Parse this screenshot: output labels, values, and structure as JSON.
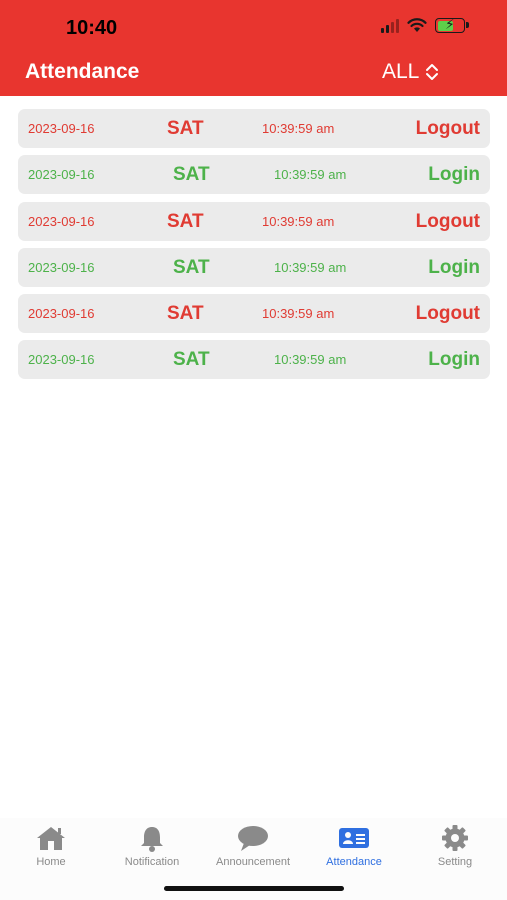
{
  "status_bar": {
    "time": "10:40"
  },
  "header": {
    "title": "Attendance",
    "filter_value": "ALL",
    "background": "#e8352f"
  },
  "records": [
    {
      "date": "2023-09-16",
      "day": "SAT",
      "time": "10:39:59 am",
      "action": "Logout",
      "type": "logout"
    },
    {
      "date": "2023-09-16",
      "day": "SAT",
      "time": "10:39:59 am",
      "action": "Login",
      "type": "login"
    },
    {
      "date": "2023-09-16",
      "day": "SAT",
      "time": "10:39:59 am",
      "action": "Logout",
      "type": "logout"
    },
    {
      "date": "2023-09-16",
      "day": "SAT",
      "time": "10:39:59 am",
      "action": "Login",
      "type": "login"
    },
    {
      "date": "2023-09-16",
      "day": "SAT",
      "time": "10:39:59 am",
      "action": "Logout",
      "type": "logout"
    },
    {
      "date": "2023-09-16",
      "day": "SAT",
      "time": "10:39:59 am",
      "action": "Login",
      "type": "login"
    }
  ],
  "colors": {
    "logout": "#e03b33",
    "login": "#4db24a",
    "active_tab": "#2f6fe0"
  },
  "tabs": [
    {
      "label": "Home",
      "icon": "house-icon",
      "active": false
    },
    {
      "label": "Notification",
      "icon": "bell-icon",
      "active": false
    },
    {
      "label": "Announcement",
      "icon": "speech-bubble-icon",
      "active": false
    },
    {
      "label": "Attendance",
      "icon": "id-card-icon",
      "active": true
    },
    {
      "label": "Setting",
      "icon": "gear-icon",
      "active": false
    }
  ]
}
